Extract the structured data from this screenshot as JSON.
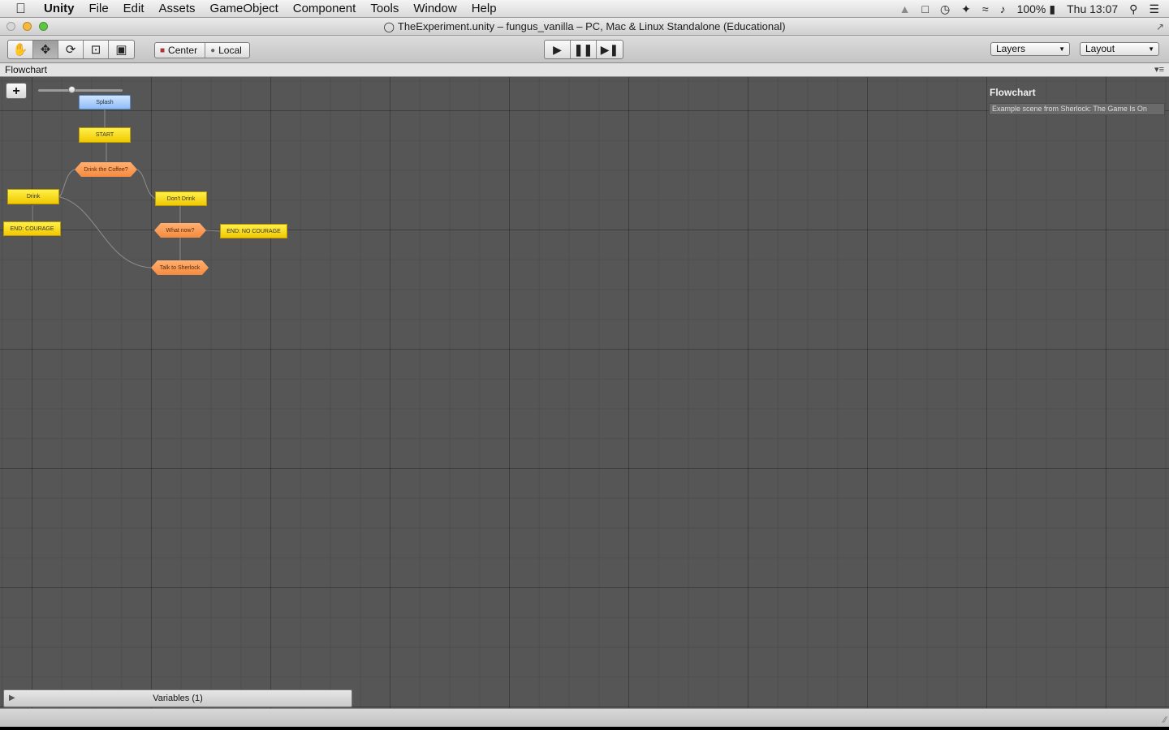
{
  "menubar": {
    "items": [
      "Unity",
      "File",
      "Edit",
      "Assets",
      "GameObject",
      "Component",
      "Tools",
      "Window",
      "Help"
    ],
    "battery": "100%",
    "clock": "Thu 13:07"
  },
  "window": {
    "title": "TheExperiment.unity – fungus_vanilla – PC, Mac & Linux Standalone (Educational)"
  },
  "toolbar": {
    "pivot_label": "Center",
    "space_label": "Local",
    "layers_label": "Layers",
    "layout_label": "Layout"
  },
  "tab": {
    "label": "Flowchart"
  },
  "flowchart": {
    "add_label": "+",
    "zoom": 0.4,
    "nodes": {
      "splash": "Splash",
      "start": "START",
      "drink_coffee": "Drink the Coffee?",
      "drink": "Drink",
      "dont_drink": "Don't Drink",
      "end_courage": "END: COURAGE",
      "what_now": "What now?",
      "end_no_courage": "END: NO COURAGE",
      "talk_sherlock": "Talk to Sherlock"
    }
  },
  "properties": {
    "title": "Flowchart",
    "description": "Example scene from Sherlock: The Game Is On"
  },
  "variables": {
    "label": "Variables (1)"
  },
  "colors": {
    "canvas": "#565656",
    "event_block": "#9cc6f7",
    "command_block": "#f5d90a",
    "choice_block": "#f7994f"
  }
}
